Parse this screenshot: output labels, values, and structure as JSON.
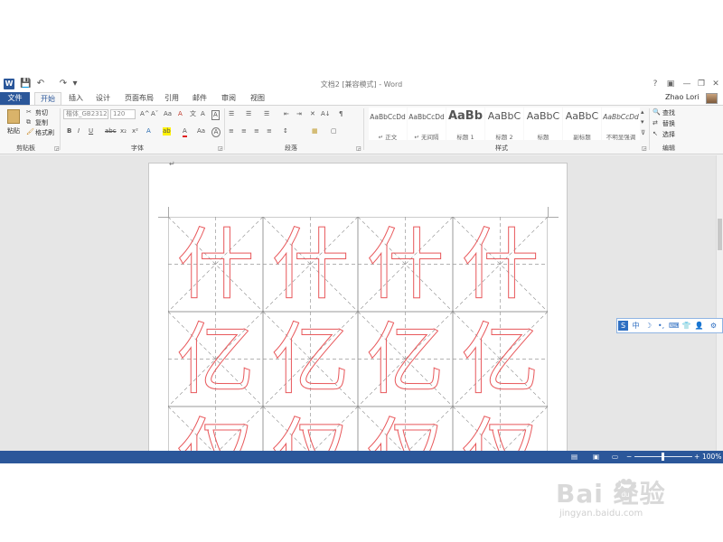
{
  "window": {
    "title": "文档2 [兼容模式] - Word",
    "app_badge": "W",
    "quick_access": {
      "save": "💾",
      "undo": "↶",
      "redo": "↷",
      "customize": "▾"
    },
    "controls": {
      "help": "?",
      "ribbon_display": "▣",
      "minimize": "—",
      "restore": "❐",
      "close": "✕"
    }
  },
  "tabs": {
    "file": "文件",
    "items": [
      "开始",
      "插入",
      "设计",
      "页面布局",
      "引用",
      "邮件",
      "审阅",
      "视图"
    ],
    "active": "开始",
    "user_name": "Zhao Lori"
  },
  "ribbon": {
    "clipboard": {
      "label": "剪贴板",
      "paste": "粘贴",
      "cut": "剪切",
      "copy": "复制",
      "format_painter": "格式刷"
    },
    "font": {
      "label": "字体",
      "font_name": "楷体_GB2312",
      "font_size": "120",
      "row1_icons": [
        "A^",
        "Aˇ",
        "Aa",
        "A"
      ],
      "row2_icons": [
        "B",
        "I",
        "U",
        "abc",
        "x₂",
        "x²",
        "A",
        "ab",
        "A",
        "Aa",
        "A"
      ]
    },
    "paragraph": {
      "label": "段落",
      "row1_icons": [
        "☰",
        "☰",
        "☰",
        "⇤",
        "⇥",
        "✕",
        "A↓",
        "¶"
      ],
      "row2_icons": [
        "≡",
        "≡",
        "≡",
        "≡",
        "↕",
        "▦",
        "▢"
      ]
    },
    "styles": {
      "label": "样式",
      "items": [
        {
          "sample": "AaBbCcDd",
          "name": "↵ 正文",
          "size": "7.5px",
          "bold": false
        },
        {
          "sample": "AaBbCcDd",
          "name": "↵ 无间隔",
          "size": "7.5px",
          "bold": false
        },
        {
          "sample": "AaBb",
          "name": "标题 1",
          "size": "13px",
          "bold": true
        },
        {
          "sample": "AaBbC",
          "name": "标题 2",
          "size": "11px",
          "bold": false
        },
        {
          "sample": "AaBbC",
          "name": "标题",
          "size": "11px",
          "bold": false
        },
        {
          "sample": "AaBbC",
          "name": "副标题",
          "size": "11px",
          "bold": false
        },
        {
          "sample": "AaBbCcDd",
          "name": "不明显强调",
          "size": "7.5px",
          "bold": false
        }
      ]
    },
    "editing": {
      "label": "编辑",
      "find": "查找",
      "replace": "替换",
      "select": "选择"
    }
  },
  "document": {
    "paragraph_mark": "↵",
    "grid": [
      [
        "什",
        "什",
        "什",
        "什"
      ],
      [
        "亿",
        "亿",
        "亿",
        "亿"
      ],
      [
        "仅",
        "仅",
        "仅",
        "仅"
      ]
    ],
    "char_color": "#e8595c",
    "grid_color": "#9a9a9a"
  },
  "ime_toolbar": {
    "items": [
      "中",
      "☽",
      "•,",
      "⌨",
      "👕",
      "👤",
      "⚙"
    ]
  },
  "statusbar": {
    "zoom": "100%",
    "zoom_minus": "−",
    "zoom_plus": "+",
    "accent": "#2b579a"
  },
  "watermark": {
    "logo": "Bai 经验",
    "url": "jingyan.baidu.com"
  }
}
